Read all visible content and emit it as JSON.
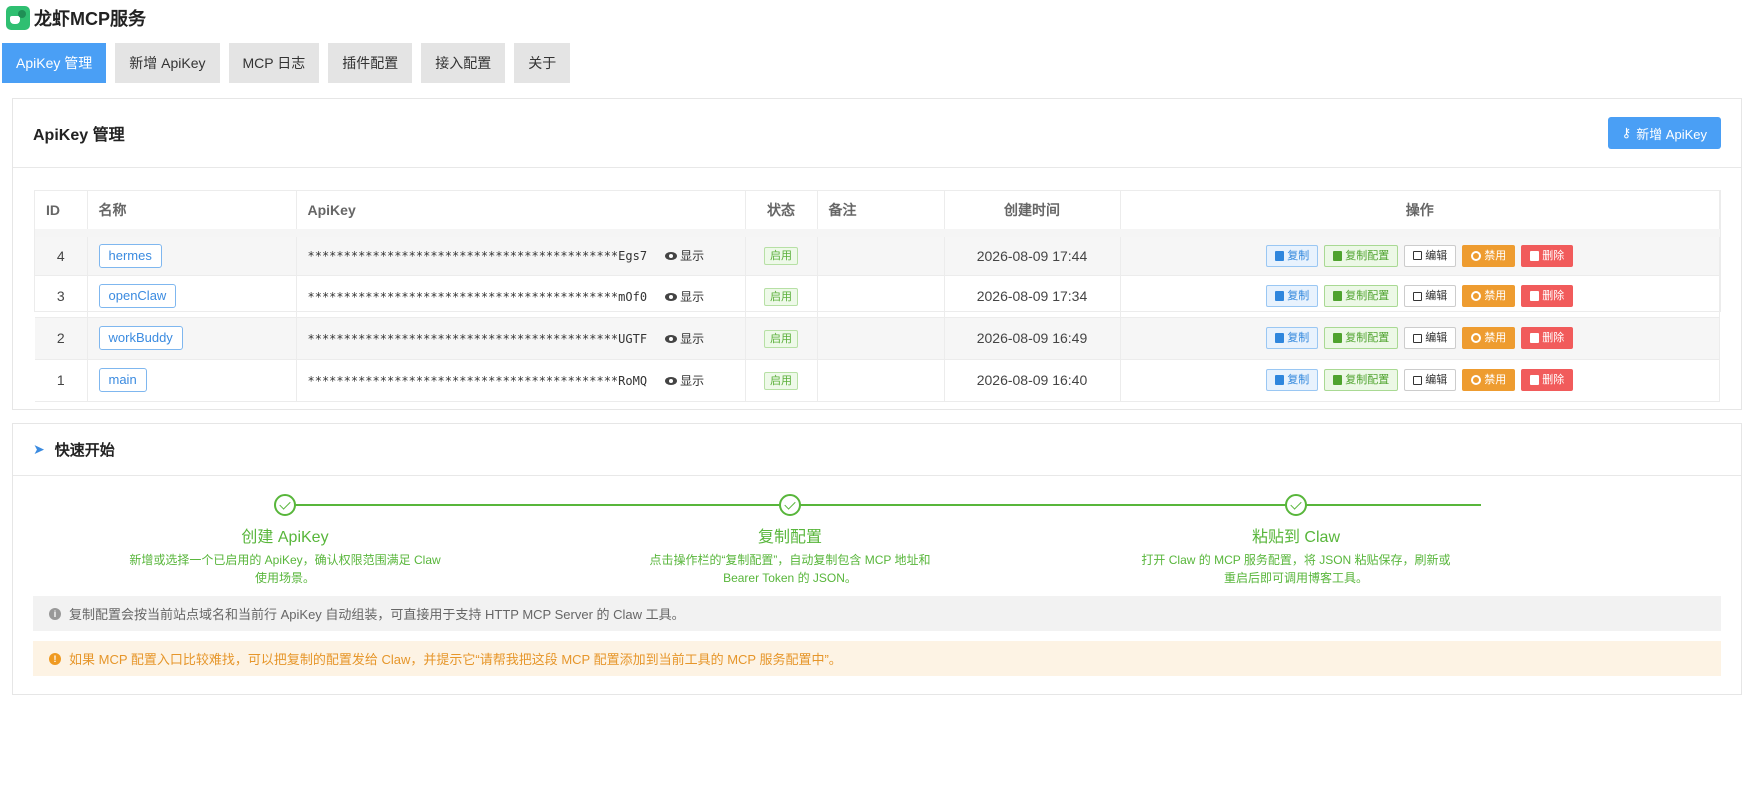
{
  "app": {
    "title": "龙虾MCP服务"
  },
  "tabs": [
    {
      "label": "ApiKey 管理",
      "active": true
    },
    {
      "label": "新增 ApiKey"
    },
    {
      "label": "MCP 日志"
    },
    {
      "label": "插件配置"
    },
    {
      "label": "接入配置"
    },
    {
      "label": "关于"
    }
  ],
  "apikey_card": {
    "title": "ApiKey 管理",
    "add_button": "新增 ApiKey",
    "columns": [
      "ID",
      "名称",
      "ApiKey",
      "状态",
      "备注",
      "创建时间",
      "操作"
    ],
    "rows": [
      {
        "id": "4",
        "name": "hermes",
        "apikey": "*******************************************Egs7",
        "show": "显示",
        "status": "启用",
        "remark": "",
        "created": "2026-08-09 17:44"
      },
      {
        "id": "3",
        "name": "openClaw",
        "apikey": "*******************************************mOf0",
        "show": "显示",
        "status": "启用",
        "remark": "",
        "created": "2026-08-09 17:34"
      },
      {
        "id": "2",
        "name": "workBuddy",
        "apikey": "*******************************************UGTF",
        "show": "显示",
        "status": "启用",
        "remark": "",
        "created": "2026-08-09 16:49"
      },
      {
        "id": "1",
        "name": "main",
        "apikey": "*******************************************RoMQ",
        "show": "显示",
        "status": "启用",
        "remark": "",
        "created": "2026-08-09 16:40"
      }
    ],
    "ops": {
      "copy": "复制",
      "copy_config": "复制配置",
      "edit": "编辑",
      "disable": "禁用",
      "delete": "删除"
    }
  },
  "quickstart": {
    "title": "快速开始",
    "steps": [
      {
        "title": "创建 ApiKey",
        "desc": "新增或选择一个已启用的 ApiKey，确认权限范围满足 Claw 使用场景。"
      },
      {
        "title": "复制配置",
        "desc": "点击操作栏的“复制配置”，自动复制包含 MCP 地址和 Bearer Token 的 JSON。"
      },
      {
        "title": "粘贴到 Claw",
        "desc": "打开 Claw 的 MCP 服务配置，将 JSON 粘贴保存，刷新或重启后即可调用博客工具。"
      }
    ],
    "info_note": "复制配置会按当前站点域名和当前行 ApiKey 自动组装，可直接用于支持 HTTP MCP Server 的 Claw 工具。",
    "warn_note": "如果 MCP 配置入口比较难找，可以把复制的配置发给 Claw，并提示它“请帮我把这段 MCP 配置添加到当前工具的 MCP 服务配置中”。"
  }
}
